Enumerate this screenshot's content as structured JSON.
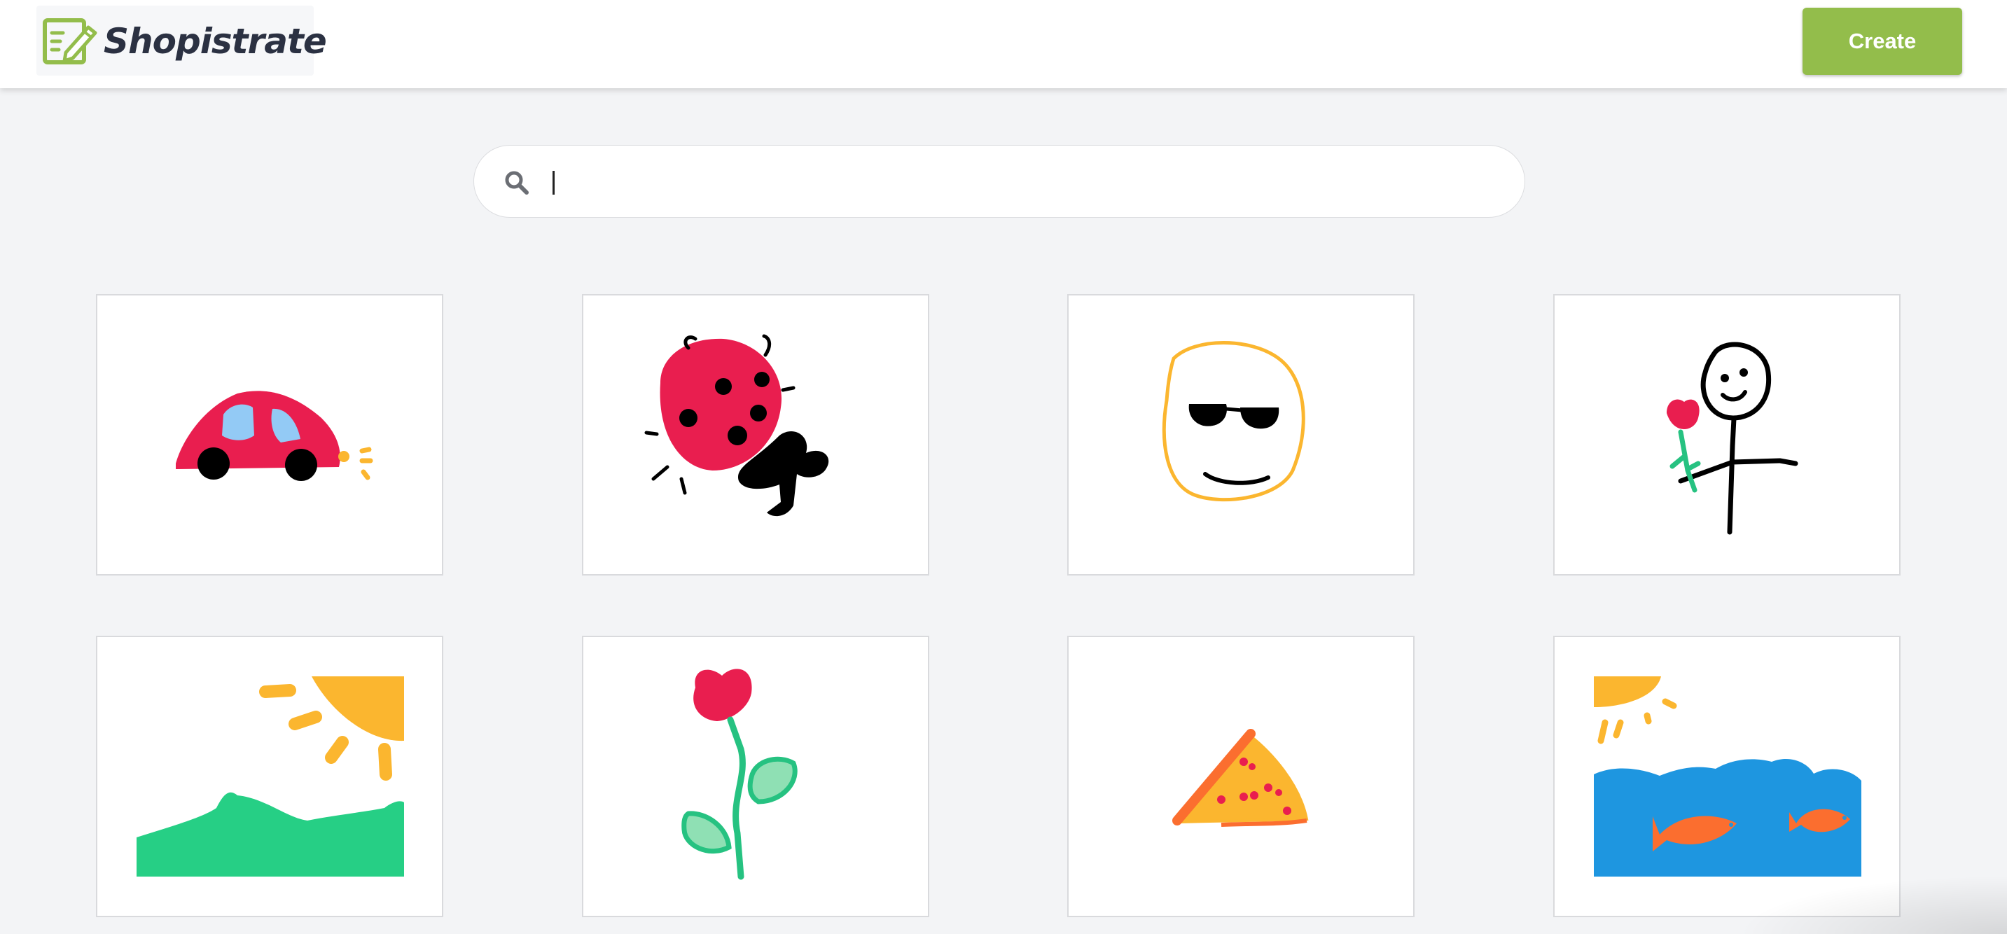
{
  "header": {
    "brand": "Shopistrate",
    "create_label": "Create"
  },
  "search": {
    "value": "",
    "icon": "search-icon"
  },
  "colors": {
    "accent": "#93bd4b",
    "brand_text": "#2b3142",
    "background": "#f3f4f6"
  },
  "drawings": [
    {
      "name": "car",
      "icon": "car-drawing-icon"
    },
    {
      "name": "ladybug",
      "icon": "ladybug-drawing-icon"
    },
    {
      "name": "sunglasses-face",
      "icon": "sunglasses-face-drawing-icon"
    },
    {
      "name": "stick-figure-with-flower",
      "icon": "stick-figure-drawing-icon"
    },
    {
      "name": "sun-and-hills",
      "icon": "landscape-drawing-icon"
    },
    {
      "name": "flower",
      "icon": "flower-drawing-icon"
    },
    {
      "name": "pizza-slice",
      "icon": "pizza-drawing-icon"
    },
    {
      "name": "fish-in-sea",
      "icon": "ocean-drawing-icon"
    }
  ]
}
